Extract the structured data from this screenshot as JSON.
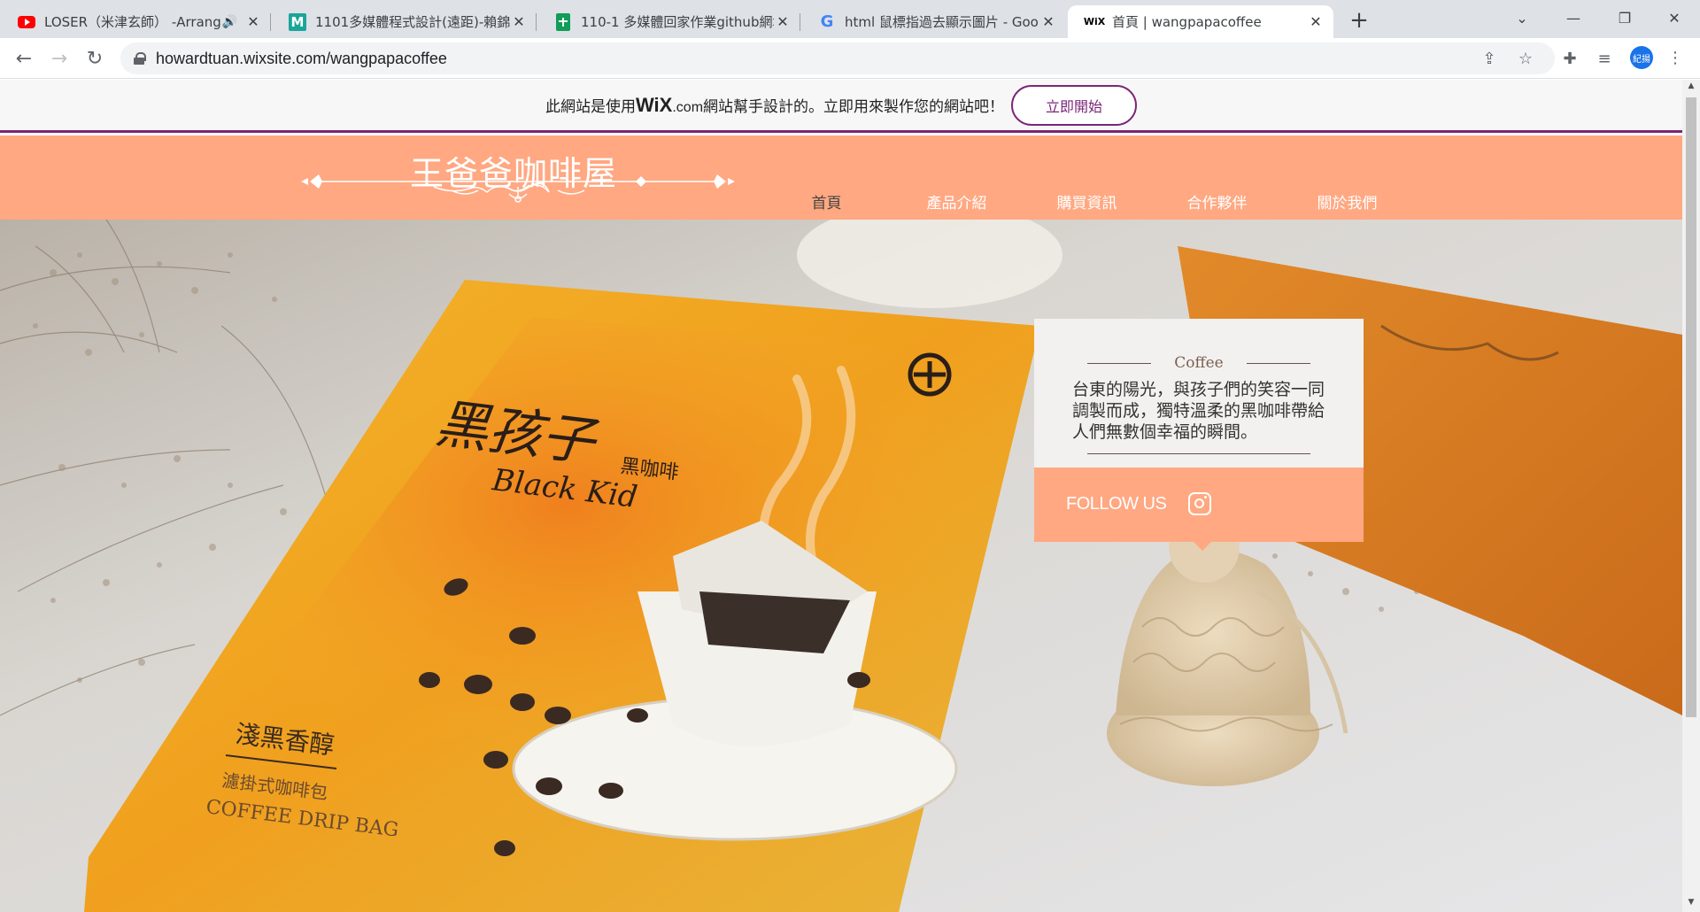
{
  "browser": {
    "tabs": [
      {
        "title": "LOSER（米津玄師） -Arrang",
        "favicon": "youtube-icon",
        "audio": "🔊"
      },
      {
        "title": "1101多媒體程式設計(遠距)-賴錦",
        "favicon": "m-icon"
      },
      {
        "title": "110-1 多媒體回家作業github網址",
        "favicon": "sheets-icon"
      },
      {
        "title": "html 鼠標指過去顯示圖片 - Goo",
        "favicon": "google-icon"
      },
      {
        "title": "首頁 | wangpapacoffee",
        "favicon": "wix-icon"
      }
    ],
    "url": "howardtuan.wixsite.com/wangpapacoffee",
    "profile_initials": "紀揚"
  },
  "wix_banner": {
    "text_before": "此網站是使用",
    "brand": "WiX",
    "brand_suffix": ".com",
    "text_after": "網站幫手設計的。立即用來製作您的網站吧！",
    "button": "立即開始"
  },
  "site": {
    "title": "王爸爸咖啡屋",
    "nav": [
      "首頁",
      "產品介紹",
      "購買資訊",
      "合作夥伴",
      "關於我們"
    ],
    "info_heading": "Coffee",
    "info_text": "台東的陽光，與孩子們的笑容一同調製而成，獨特溫柔的黑咖啡帶給人們無數個幸福的瞬間。",
    "follow_label": "FOLLOW US"
  },
  "hero_image": {
    "package_brand": "黑孩子",
    "package_brand_en": "Black Kid",
    "package_type": "黑咖啡",
    "package_line1": "淺黑香醇",
    "package_line2": "濾掛式咖啡包",
    "package_line3": "COFFEE DRIP BAG"
  },
  "colors": {
    "header": "#ffa882",
    "accent": "#7b2577",
    "info_bg": "#f3f1ef"
  }
}
